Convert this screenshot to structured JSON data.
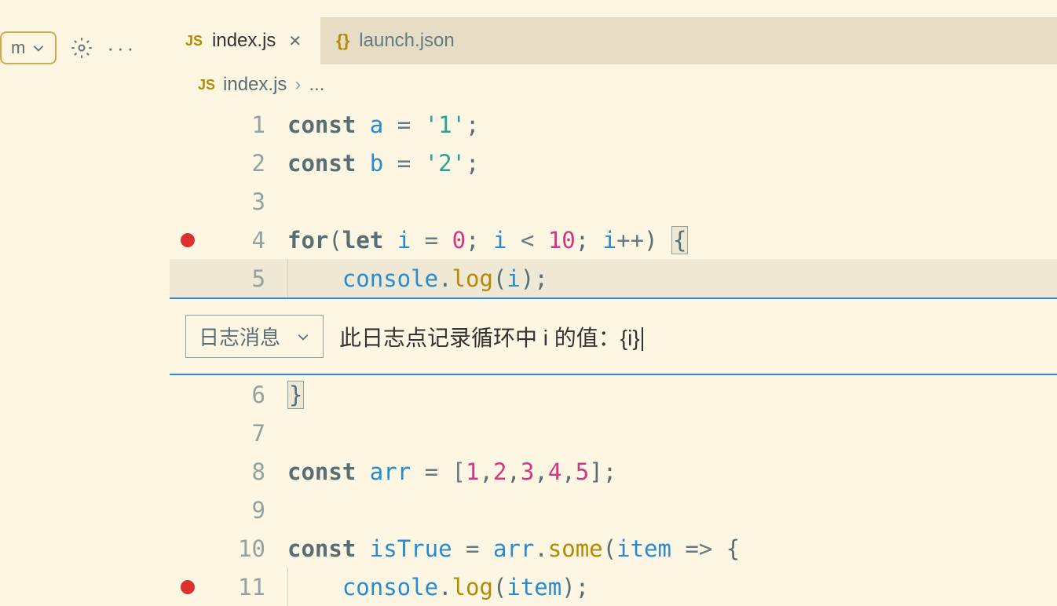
{
  "tabs": [
    {
      "icon": "JS",
      "label": "index.js",
      "active": true,
      "closable": true
    },
    {
      "icon": "{}",
      "label": "launch.json",
      "active": false,
      "closable": false
    }
  ],
  "breadcrumb": {
    "icon": "JS",
    "file": "index.js",
    "sep": "›",
    "more": "..."
  },
  "logpoint": {
    "type_label": "日志消息",
    "message": "此日志点记录循环中 i 的值：{i}"
  },
  "lines": [
    {
      "num": "1",
      "breakpoint": false
    },
    {
      "num": "2",
      "breakpoint": false
    },
    {
      "num": "3",
      "breakpoint": false
    },
    {
      "num": "4",
      "breakpoint": true
    },
    {
      "num": "5",
      "breakpoint": false,
      "highlighted": true
    },
    {
      "num": "6",
      "breakpoint": false
    },
    {
      "num": "7",
      "breakpoint": false
    },
    {
      "num": "8",
      "breakpoint": false
    },
    {
      "num": "9",
      "breakpoint": false
    },
    {
      "num": "10",
      "breakpoint": false
    },
    {
      "num": "11",
      "breakpoint": true
    }
  ],
  "code": {
    "l1": {
      "kw": "const",
      "var": "a",
      "op": " = ",
      "str": "'1'",
      "end": ";"
    },
    "l2": {
      "kw": "const",
      "var": "b",
      "op": " = ",
      "str": "'2'",
      "end": ";"
    },
    "l4": {
      "kw1": "for",
      "p1": "(",
      "kw2": "let",
      "var": "i",
      "op1": " = ",
      "n1": "0",
      "p2": "; ",
      "var2": "i",
      "op2": " < ",
      "n2": "10",
      "p3": "; ",
      "var3": "i",
      "op3": "++",
      "p4": ") ",
      "brace": "{"
    },
    "l5": {
      "obj": "console",
      "dot": ".",
      "fn": "log",
      "p1": "(",
      "var": "i",
      "p2": ")",
      "end": ";"
    },
    "l6": {
      "brace": "}"
    },
    "l8": {
      "kw": "const",
      "var": "arr",
      "op": " = [",
      "n1": "1",
      "c": ",",
      "n2": "2",
      "n3": "3",
      "n4": "4",
      "n5": "5",
      "end": "];"
    },
    "l10": {
      "kw": "const",
      "var": "isTrue",
      "op": " = ",
      "obj": "arr",
      "dot": ".",
      "fn": "some",
      "p1": "(",
      "param": "item",
      "arrow": " => ",
      "brace": "{"
    },
    "l11": {
      "obj": "console",
      "dot": ".",
      "fn": "log",
      "p1": "(",
      "var": "item",
      "p2": ")",
      "end": ";"
    }
  },
  "toolbar": {
    "dropdown_fragment": "m"
  }
}
